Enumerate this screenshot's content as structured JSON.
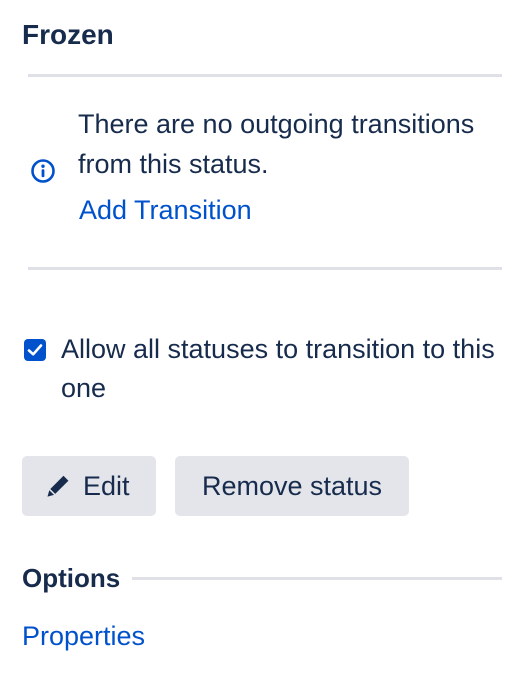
{
  "status": {
    "title": "Frozen"
  },
  "transitions": {
    "message": "There are no outgoing transitions from this status.",
    "add_link": "Add Transition",
    "icon": "info-circle-icon"
  },
  "allow_all": {
    "checked": true,
    "label": "Allow all statuses to transition to this one"
  },
  "actions": {
    "edit_label": "Edit",
    "edit_icon": "pencil-icon",
    "remove_label": "Remove status"
  },
  "options": {
    "title": "Options",
    "properties_link": "Properties"
  },
  "colors": {
    "text": "#172b4d",
    "link": "#0052cc",
    "button_bg": "#e4e5ea",
    "divider": "#dfe1e6",
    "checkbox": "#0052cc"
  }
}
